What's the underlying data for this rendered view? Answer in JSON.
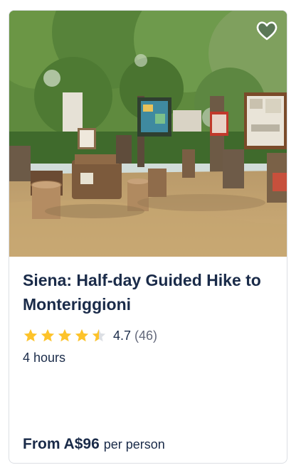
{
  "card": {
    "image_alt": "Wooden benches and signboards under trees",
    "wishlist_icon": "heart-outline-icon",
    "title": "Siena: Half-day Guided Hike to Monteriggioni",
    "rating": {
      "stars": 4.7,
      "value": "4.7",
      "count": "(46)",
      "star_color": "#fdc32a"
    },
    "duration": "4 hours",
    "price": {
      "amount": "From A$96",
      "unit": "per person"
    }
  }
}
